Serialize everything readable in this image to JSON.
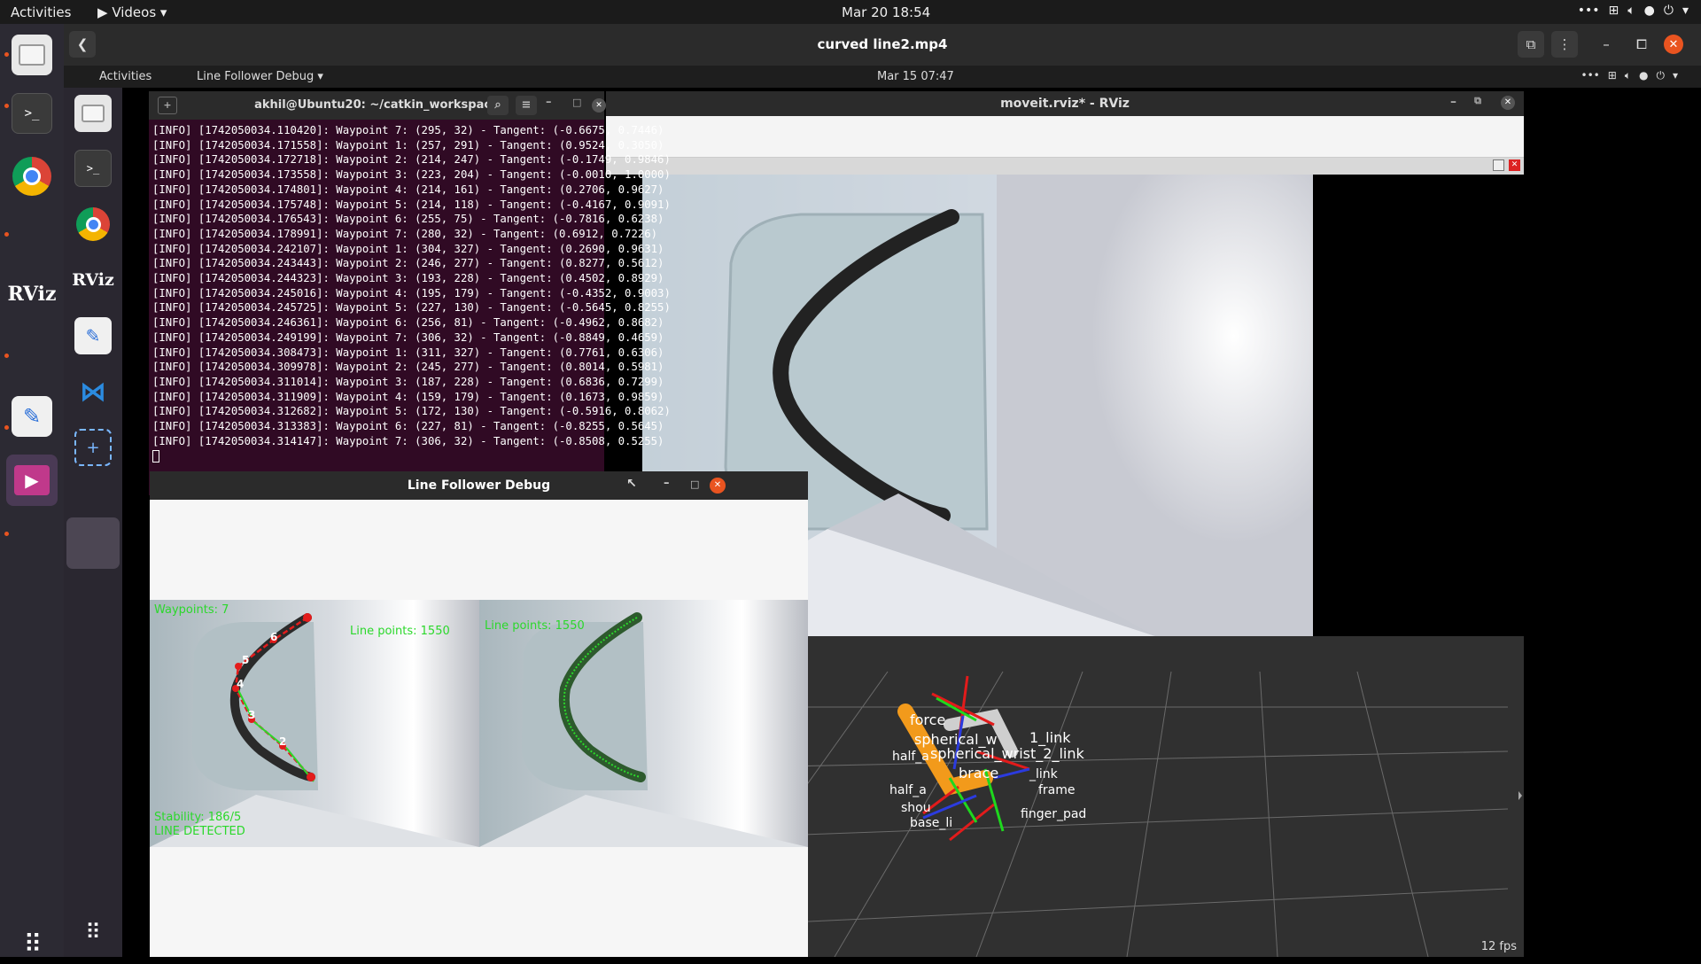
{
  "host_topbar": {
    "activities": "Activities",
    "app_menu": "Videos",
    "clock": "Mar 20  18:54",
    "tray_icons": [
      "more-icon",
      "network-icon",
      "volume-icon",
      "mic-icon",
      "power-icon",
      "chevron-down-icon"
    ]
  },
  "host_dock": {
    "apps": [
      "Files",
      "Terminal",
      "Chrome",
      "RViz",
      "Text Editor",
      "Videos",
      "Show Applications"
    ],
    "rviz_label": "RViz"
  },
  "player": {
    "title": "curved line2.mp4",
    "back_icon": "chevron-left-icon"
  },
  "inner_desktop": {
    "activities": "Activities",
    "app_menu": "Line Follower Debug",
    "clock": "Mar 15  07:47",
    "rviz_label": "RViz"
  },
  "terminal": {
    "title": "akhil@Ubuntu20: ~/catkin_workspace",
    "lines": [
      "[INFO] [1742050034.110420]: Waypoint 7: (295, 32) - Tangent: (-0.6675, 0.7446)",
      "[INFO] [1742050034.171558]: Waypoint 1: (257, 291) - Tangent: (0.9524, 0.3050)",
      "[INFO] [1742050034.172718]: Waypoint 2: (214, 247) - Tangent: (-0.1749, 0.9846)",
      "[INFO] [1742050034.173558]: Waypoint 3: (223, 204) - Tangent: (-0.0010, 1.0000)",
      "[INFO] [1742050034.174801]: Waypoint 4: (214, 161) - Tangent: (0.2706, 0.9627)",
      "[INFO] [1742050034.175748]: Waypoint 5: (214, 118) - Tangent: (-0.4167, 0.9091)",
      "[INFO] [1742050034.176543]: Waypoint 6: (255, 75) - Tangent: (-0.7816, 0.6238)",
      "[INFO] [1742050034.178991]: Waypoint 7: (280, 32) - Tangent: (0.6912, 0.7226)",
      "[INFO] [1742050034.242107]: Waypoint 1: (304, 327) - Tangent: (0.2690, 0.9631)",
      "[INFO] [1742050034.243443]: Waypoint 2: (246, 277) - Tangent: (0.8277, 0.5612)",
      "[INFO] [1742050034.244323]: Waypoint 3: (193, 228) - Tangent: (0.4502, 0.8929)",
      "[INFO] [1742050034.245016]: Waypoint 4: (195, 179) - Tangent: (-0.4352, 0.9003)",
      "[INFO] [1742050034.245725]: Waypoint 5: (227, 130) - Tangent: (-0.5645, 0.8255)",
      "[INFO] [1742050034.246361]: Waypoint 6: (256, 81) - Tangent: (-0.4962, 0.8682)",
      "[INFO] [1742050034.249199]: Waypoint 7: (306, 32) - Tangent: (-0.8849, 0.4659)",
      "[INFO] [1742050034.308473]: Waypoint 1: (311, 327) - Tangent: (0.7761, 0.6306)",
      "[INFO] [1742050034.309978]: Waypoint 2: (245, 277) - Tangent: (0.8014, 0.5981)",
      "[INFO] [1742050034.311014]: Waypoint 3: (187, 228) - Tangent: (0.6836, 0.7299)",
      "[INFO] [1742050034.311909]: Waypoint 4: (159, 179) - Tangent: (0.1673, 0.9859)",
      "[INFO] [1742050034.312682]: Waypoint 5: (172, 130) - Tangent: (-0.5916, 0.8062)",
      "[INFO] [1742050034.313383]: Waypoint 6: (227, 81) - Tangent: (-0.8255, 0.5645)",
      "[INFO] [1742050034.314147]: Waypoint 7: (306, 32) - Tangent: (-0.8508, 0.5255)"
    ]
  },
  "debug": {
    "title": "Line Follower Debug",
    "waypoints_label": "Waypoints: 7",
    "line_points_left": "Line points: 1550",
    "line_points_right": "Line points: 1550",
    "stability": "Stability: 186/5",
    "detected": "LINE DETECTED",
    "waypoint_numbers": [
      "2",
      "3",
      "4",
      "5",
      "6"
    ]
  },
  "rviz": {
    "title": "moveit.rviz* - RViz",
    "fps": "12 fps",
    "robot_labels": [
      "force",
      "spherical_w",
      "spherical_wrist_2_link",
      "half_a",
      "1_link",
      "brace",
      "_link",
      "half_a",
      "frame",
      "shou",
      "base_li",
      "finger_pad"
    ]
  },
  "colors": {
    "terminal_bg": "#300a24",
    "accent": "#e95420",
    "overlay_text": "#2bd82b",
    "waypoint_dot": "#e31c1c"
  }
}
